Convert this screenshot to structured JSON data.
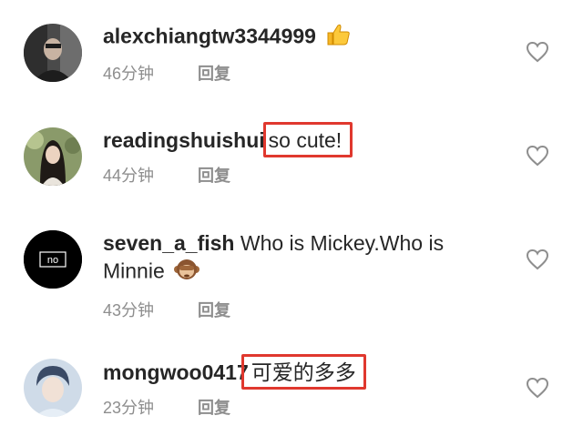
{
  "comments": [
    {
      "username": "alexchiangtw3344999",
      "text": "",
      "emoji": "thumbs-up-emoji",
      "time": "46分钟",
      "reply": "回复"
    },
    {
      "username": "readingshuishui",
      "text": "so cute!",
      "time": "44分钟",
      "reply": "回复"
    },
    {
      "username": "seven_a_fish",
      "text_line1": "Who is Mickey.Who is",
      "text_line2": "Minnie",
      "emoji": "monkey-emoji",
      "avatar_label": "no",
      "time": "43分钟",
      "reply": "回复"
    },
    {
      "username": "mongwoo0417",
      "text": "可爱的多多",
      "time": "23分钟",
      "reply": "回复"
    }
  ],
  "colors": {
    "highlight_border": "#e0382e",
    "meta_gray": "#8e8e8e",
    "text": "#262626"
  }
}
